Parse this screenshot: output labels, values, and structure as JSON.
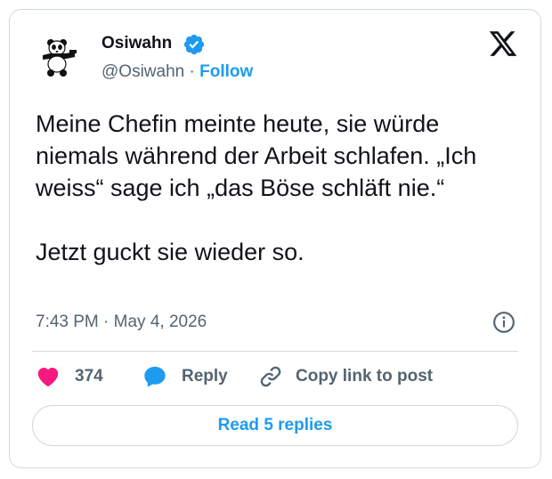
{
  "author": {
    "name": "Osiwahn",
    "handle": "@Osiwahn",
    "separator": "·",
    "follow_label": "Follow",
    "verified": true
  },
  "tweet": {
    "text": "Meine Chefin meinte heute, sie würde niemals während der Arbeit schlafen. „Ich weiss“ sage ich „das Böse schläft nie.“\n\nJetzt guckt sie wieder so.",
    "timestamp": "7:43 PM · May 4, 2026"
  },
  "actions": {
    "like_count": "374",
    "reply_label": "Reply",
    "copy_label": "Copy link to post"
  },
  "replies_button": "Read 5 replies",
  "icons": {
    "avatar": "panda-avatar",
    "verified": "verified-badge-icon",
    "brand": "x-logo-icon",
    "info": "info-icon",
    "like": "heart-icon",
    "reply": "speech-bubble-icon",
    "copy": "link-icon"
  },
  "colors": {
    "accent": "#1d9bf0",
    "like": "#f91880",
    "text": "#0f1419",
    "muted": "#536471",
    "border": "#cfd9de"
  }
}
